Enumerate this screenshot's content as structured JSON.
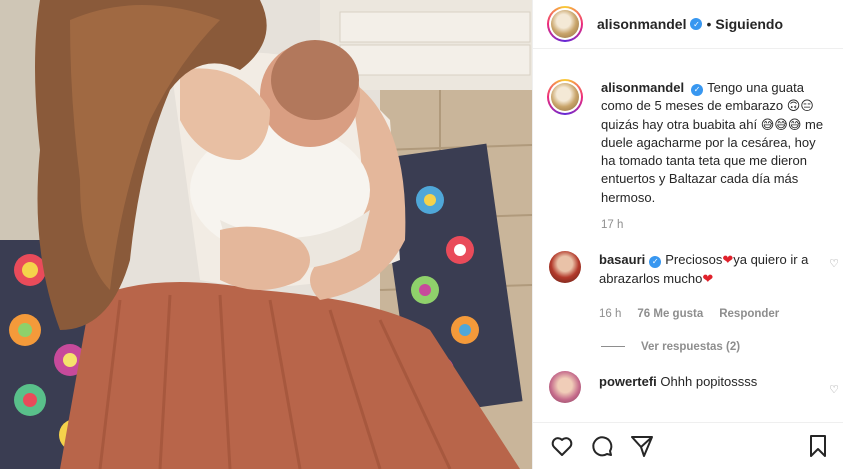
{
  "post": {
    "username": "alisonmandel",
    "dot": "•",
    "follow_status": "Siguiendo"
  },
  "caption": {
    "username": "alisonmandel",
    "text": "Tengo una guata como de 5 meses de embarazo 🙃😑 quizás hay otra buabita ahí 😅😅😅 me duele agacharme por la cesárea, hoy ha tomado tanta teta que me dieron entuertos y Baltazar cada día más hermoso.",
    "time": "17 h"
  },
  "comments": [
    {
      "username": "basauri",
      "text_part1": "Preciosos",
      "heart1": "❤",
      "text_part2": "ya quiero ir a abrazarlos mucho",
      "heart2": "❤",
      "time": "16 h",
      "likes": "76 Me gusta",
      "reply": "Responder",
      "view_replies": "Ver respuestas (2)"
    },
    {
      "username": "powertefi",
      "text": "Ohhh popitossss"
    }
  ],
  "icons": {
    "like": "heart-outline-icon",
    "comment": "comment-bubble-icon",
    "share": "paper-plane-icon",
    "save": "bookmark-icon",
    "verified": "verified-badge-icon"
  },
  "colors": {
    "verified": "#3897f0",
    "heart": "#e0212b",
    "muted": "#8e8e8e"
  }
}
